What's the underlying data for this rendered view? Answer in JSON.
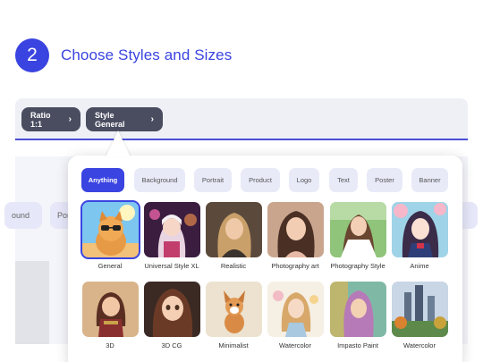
{
  "step": {
    "number": "2",
    "title": "Choose Styles and Sizes"
  },
  "toolbar": {
    "ratio_label": "Ratio 1:1",
    "style_label": "Style General",
    "chevron": "›"
  },
  "background_chips": [
    "ound",
    "Por"
  ],
  "popup": {
    "tabs": [
      {
        "label": "Anything",
        "active": true
      },
      {
        "label": "Background",
        "active": false
      },
      {
        "label": "Portrait",
        "active": false
      },
      {
        "label": "Product",
        "active": false
      },
      {
        "label": "Logo",
        "active": false
      },
      {
        "label": "Text",
        "active": false
      },
      {
        "label": "Poster",
        "active": false
      },
      {
        "label": "Banner",
        "active": false
      }
    ],
    "styles": [
      {
        "label": "General",
        "icon": "cat-sunglasses-thumbnail",
        "selected": true
      },
      {
        "label": "Universal Style XL",
        "icon": "neon-girl-thumbnail",
        "selected": false
      },
      {
        "label": "Realistic",
        "icon": "realistic-woman-thumbnail",
        "selected": false
      },
      {
        "label": "Photography art",
        "icon": "photo-art-woman-thumbnail",
        "selected": false
      },
      {
        "label": "Photography Style",
        "icon": "bride-thumbnail",
        "selected": false
      },
      {
        "label": "Anime",
        "icon": "anime-girl-thumbnail",
        "selected": false
      },
      {
        "label": "3D",
        "icon": "3d-warrior-girl-thumbnail",
        "selected": false
      },
      {
        "label": "3D CG",
        "icon": "3d-cg-girl-thumbnail",
        "selected": false
      },
      {
        "label": "Minimalist",
        "icon": "minimalist-dog-thumbnail",
        "selected": false
      },
      {
        "label": "Watercolor",
        "icon": "watercolor-girl-thumbnail",
        "selected": false
      },
      {
        "label": "Impasto Paint",
        "icon": "impasto-girl-thumbnail",
        "selected": false
      },
      {
        "label": "Watercolor",
        "icon": "watercolor-city-thumbnail",
        "selected": false
      }
    ]
  },
  "colors": {
    "accent": "#3a44e0",
    "pill": "#4a4d60",
    "tab_bg": "#e9eaf8"
  }
}
